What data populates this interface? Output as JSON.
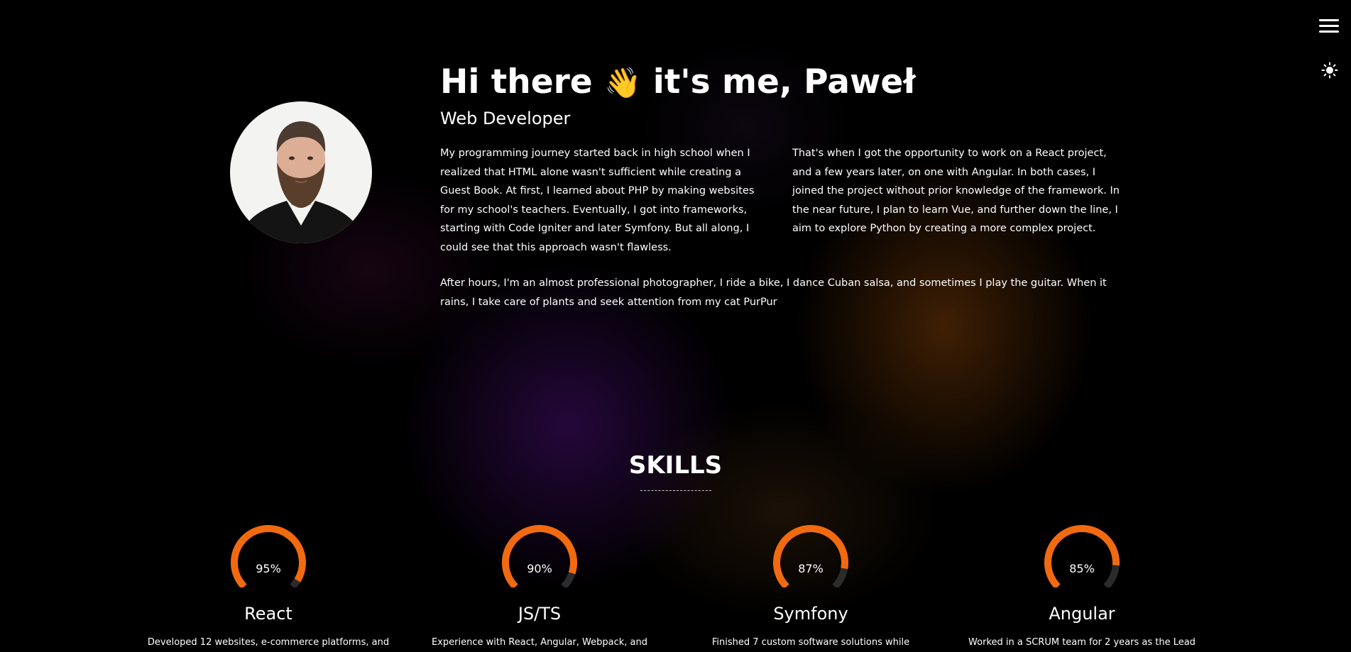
{
  "nav": {
    "menu_icon": "hamburger-menu-icon",
    "theme_icon": "sun-icon"
  },
  "hero": {
    "title_part1": "Hi there",
    "wave_emoji": "👋",
    "title_part2": "it's me, Paweł",
    "subtitle": "Web Developer",
    "bio_left": "My programming journey started back in high school when I realized that HTML alone wasn't sufficient while creating a Guest Book. At first, I learned about PHP by making websites for my school's teachers. Eventually, I got into frameworks, starting with Code Igniter and later Symfony. But all along, I could see that this approach wasn't flawless.",
    "bio_right": "That's when I got the opportunity to work on a React project, and a few years later, on one with Angular. In both cases, I joined the project without prior knowledge of the framework. In the near future, I plan to learn Vue, and further down the line, I aim to explore Python by creating a more complex project.",
    "bio_hobbies": "After hours, I'm an almost professional photographer, I ride a bike, I dance Cuban salsa, and sometimes I play the guitar. When it rains, I take care of plants and seek attention from my cat  PurPur"
  },
  "skills": {
    "title": "SKILLS",
    "items": [
      {
        "name": "React",
        "percent": 95,
        "percent_label": "95%",
        "description": "Developed 12 websites, e-commerce platforms, and"
      },
      {
        "name": "JS/TS",
        "percent": 90,
        "percent_label": "90%",
        "description": "Experience with React, Angular, Webpack, and"
      },
      {
        "name": "Symfony",
        "percent": 87,
        "percent_label": "87%",
        "description": "Finished 7 custom software solutions while"
      },
      {
        "name": "Angular",
        "percent": 85,
        "percent_label": "85%",
        "description": "Worked in a SCRUM team for 2 years as the Lead"
      }
    ]
  },
  "colors": {
    "background": "#000000",
    "text": "#ffffff",
    "gauge_fill": "#f26a10",
    "gauge_track": "#2b2b2b"
  }
}
